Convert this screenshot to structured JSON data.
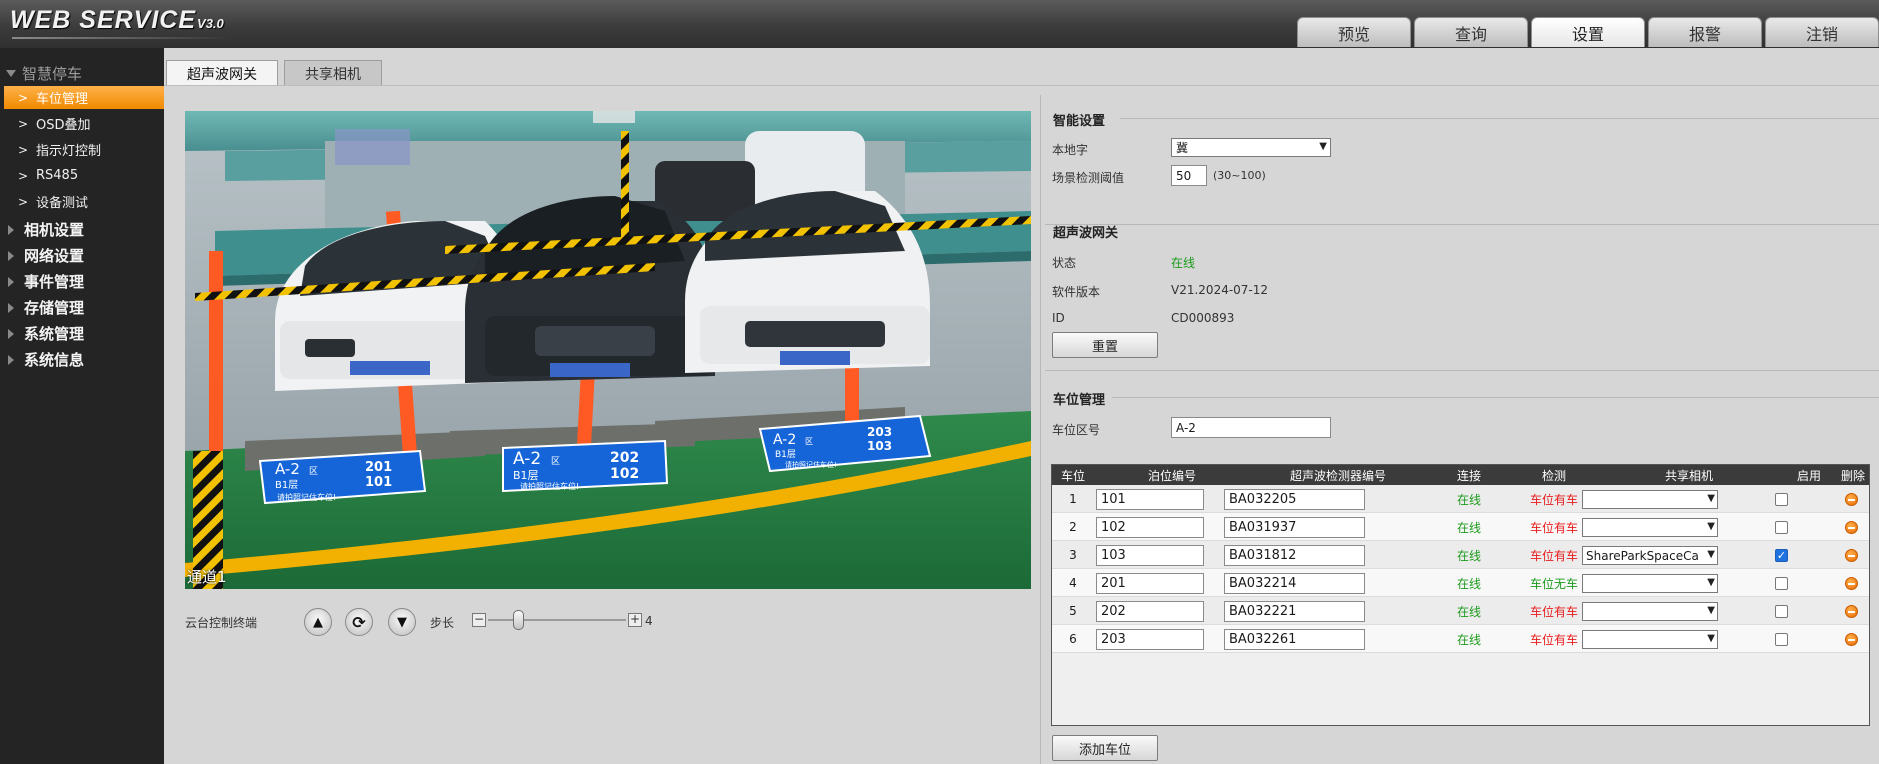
{
  "header": {
    "logo": "WEB  SERVICE",
    "logo_version": "V3.0",
    "nav": [
      "预览",
      "查询",
      "设置",
      "报警",
      "注销"
    ],
    "nav_active": "设置"
  },
  "sidebar": {
    "section": "智慧停车",
    "sub_items": [
      "车位管理",
      "OSD叠加",
      "指示灯控制",
      "RS485",
      "设备测试"
    ],
    "active_sub": "车位管理",
    "groups": [
      "相机设置",
      "网络设置",
      "事件管理",
      "存储管理",
      "系统管理",
      "系统信息"
    ]
  },
  "sub_tabs": [
    "超声波网关",
    "共享相机"
  ],
  "video": {
    "channel_label": "通道1",
    "slot_signs": [
      {
        "zone": "A-2",
        "zone_suffix": "区",
        "floor": "B1层",
        "num_top": "201",
        "num_bottom": "101",
        "slogan": "请拍照记住车位!"
      },
      {
        "zone": "A-2",
        "zone_suffix": "区",
        "floor": "B1层",
        "num_top": "202",
        "num_bottom": "102",
        "slogan": "请拍照记住车位!"
      },
      {
        "zone": "A-2",
        "zone_suffix": "区",
        "floor": "B1层",
        "num_top": "203",
        "num_bottom": "103",
        "slogan": "请拍照记住车位!"
      }
    ]
  },
  "ptz": {
    "label": "云台控制终端",
    "up_glyph": "▲",
    "refresh_glyph": "⟳",
    "down_glyph": "▼",
    "step_label": "步长",
    "step_value": "4",
    "step_fraction": 0.2,
    "minus": "−",
    "plus": "+"
  },
  "smart_settings": {
    "title": "智能设置",
    "local_char_label": "本地字",
    "local_char_value": "冀",
    "threshold_label": "场景检测阈值",
    "threshold_value": "50",
    "threshold_range": "(30~100)"
  },
  "gateway": {
    "title": "超声波网关",
    "status_label": "状态",
    "status_value": "在线",
    "version_label": "软件版本",
    "version_value": "V21.2024-07-12",
    "id_label": "ID",
    "id_value": "CD000893",
    "reset_button": "重置"
  },
  "space_mgmt": {
    "title": "车位管理",
    "zone_label": "车位区号",
    "zone_value": "A-2",
    "add_button": "添加车位",
    "columns": [
      "车位",
      "泊位编号",
      "超声波检测器编号",
      "连接",
      "检测",
      "共享相机",
      "启用",
      "删除"
    ],
    "rows": [
      {
        "no": "1",
        "berth": "101",
        "detector": "BA032205",
        "connection": "在线",
        "detect": "车位有车",
        "camera": "",
        "enabled": false
      },
      {
        "no": "2",
        "berth": "102",
        "detector": "BA031937",
        "connection": "在线",
        "detect": "车位有车",
        "camera": "",
        "enabled": false
      },
      {
        "no": "3",
        "berth": "103",
        "detector": "BA031812",
        "connection": "在线",
        "detect": "车位有车",
        "camera": "ShareParkSpaceCa",
        "enabled": true
      },
      {
        "no": "4",
        "berth": "201",
        "detector": "BA032214",
        "connection": "在线",
        "detect": "车位无车",
        "camera": "",
        "enabled": false
      },
      {
        "no": "5",
        "berth": "202",
        "detector": "BA032221",
        "connection": "在线",
        "detect": "车位有车",
        "camera": "",
        "enabled": false
      },
      {
        "no": "6",
        "berth": "203",
        "detector": "BA032261",
        "connection": "在线",
        "detect": "车位有车",
        "camera": "",
        "enabled": false
      }
    ]
  },
  "colors": {
    "accent_orange": "#f08a00",
    "online_green": "#1b9a1b",
    "occupied_red": "#e81c1c",
    "checkbox_blue": "#1e73e0"
  }
}
